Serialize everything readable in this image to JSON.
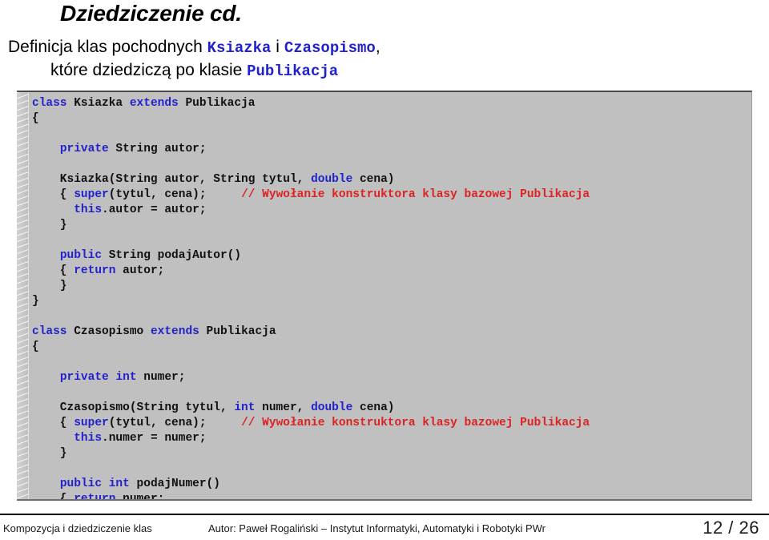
{
  "slide": {
    "title": "Dziedziczenie cd.",
    "subtitle": {
      "line1_pre": "Definicja klas pochodnych ",
      "line1_code1": "Ksiazka",
      "line1_mid": " i ",
      "line1_code2": "Czasopismo",
      "line1_post": ",",
      "line2_pre": "które dziedziczą po klasie ",
      "line2_code": "Publikacja"
    }
  },
  "colors": {
    "keyword_blue": "#2222cc",
    "comment_red": "#dd2222",
    "code_background": "#c0c0c0",
    "text_black": "#000000"
  },
  "code": {
    "language": "Java",
    "lines": [
      [
        {
          "t": "class",
          "c": "kw"
        },
        {
          "t": " Ksiazka ",
          "c": "id"
        },
        {
          "t": "extends",
          "c": "kw"
        },
        {
          "t": " Publikacja",
          "c": "id"
        }
      ],
      [
        {
          "t": "{",
          "c": "id"
        }
      ],
      [
        {
          "t": "",
          "c": "id"
        }
      ],
      [
        {
          "t": "    ",
          "c": "id"
        },
        {
          "t": "private",
          "c": "kw"
        },
        {
          "t": " String autor;",
          "c": "id"
        }
      ],
      [
        {
          "t": "",
          "c": "id"
        }
      ],
      [
        {
          "t": "    Ksiazka(String autor, String tytul, ",
          "c": "id"
        },
        {
          "t": "double",
          "c": "kw"
        },
        {
          "t": " cena)",
          "c": "id"
        }
      ],
      [
        {
          "t": "    { ",
          "c": "id"
        },
        {
          "t": "super",
          "c": "kw"
        },
        {
          "t": "(tytul, cena);     ",
          "c": "id"
        },
        {
          "t": "// Wywołanie konstruktora klasy bazowej Publikacja",
          "c": "cm"
        }
      ],
      [
        {
          "t": "      ",
          "c": "id"
        },
        {
          "t": "this",
          "c": "kw"
        },
        {
          "t": ".autor = autor;",
          "c": "id"
        }
      ],
      [
        {
          "t": "    }",
          "c": "id"
        }
      ],
      [
        {
          "t": "",
          "c": "id"
        }
      ],
      [
        {
          "t": "    ",
          "c": "id"
        },
        {
          "t": "public",
          "c": "kw"
        },
        {
          "t": " String podajAutor()",
          "c": "id"
        }
      ],
      [
        {
          "t": "    { ",
          "c": "id"
        },
        {
          "t": "return",
          "c": "kw"
        },
        {
          "t": " autor;",
          "c": "id"
        }
      ],
      [
        {
          "t": "    }",
          "c": "id"
        }
      ],
      [
        {
          "t": "}",
          "c": "id"
        }
      ],
      [
        {
          "t": "",
          "c": "id"
        }
      ],
      [
        {
          "t": "class",
          "c": "kw"
        },
        {
          "t": " Czasopismo ",
          "c": "id"
        },
        {
          "t": "extends",
          "c": "kw"
        },
        {
          "t": " Publikacja",
          "c": "id"
        }
      ],
      [
        {
          "t": "{",
          "c": "id"
        }
      ],
      [
        {
          "t": "",
          "c": "id"
        }
      ],
      [
        {
          "t": "    ",
          "c": "id"
        },
        {
          "t": "private",
          "c": "kw"
        },
        {
          "t": " ",
          "c": "id"
        },
        {
          "t": "int",
          "c": "kw"
        },
        {
          "t": " numer;",
          "c": "id"
        }
      ],
      [
        {
          "t": "",
          "c": "id"
        }
      ],
      [
        {
          "t": "    Czasopismo(String tytul, ",
          "c": "id"
        },
        {
          "t": "int",
          "c": "kw"
        },
        {
          "t": " numer, ",
          "c": "id"
        },
        {
          "t": "double",
          "c": "kw"
        },
        {
          "t": " cena)",
          "c": "id"
        }
      ],
      [
        {
          "t": "    { ",
          "c": "id"
        },
        {
          "t": "super",
          "c": "kw"
        },
        {
          "t": "(tytul, cena);     ",
          "c": "id"
        },
        {
          "t": "// Wywołanie konstruktora klasy bazowej Publikacja",
          "c": "cm"
        }
      ],
      [
        {
          "t": "      ",
          "c": "id"
        },
        {
          "t": "this",
          "c": "kw"
        },
        {
          "t": ".numer = numer;",
          "c": "id"
        }
      ],
      [
        {
          "t": "    }",
          "c": "id"
        }
      ],
      [
        {
          "t": "",
          "c": "id"
        }
      ],
      [
        {
          "t": "    ",
          "c": "id"
        },
        {
          "t": "public",
          "c": "kw"
        },
        {
          "t": " ",
          "c": "id"
        },
        {
          "t": "int",
          "c": "kw"
        },
        {
          "t": " podajNumer()",
          "c": "id"
        }
      ],
      [
        {
          "t": "    { ",
          "c": "id"
        },
        {
          "t": "return",
          "c": "kw"
        },
        {
          "t": " numer;",
          "c": "id"
        }
      ],
      [
        {
          "t": "    }",
          "c": "id"
        }
      ],
      [
        {
          "t": "}",
          "c": "id"
        }
      ]
    ]
  },
  "footer": {
    "left": "Kompozycja i dziedziczenie klas",
    "center": "Autor: Paweł Rogaliński – Instytut Informatyki, Automatyki i Robotyki PWr",
    "page_current": "12",
    "page_separator": "/",
    "page_total": "26",
    "page_label": "12 / 26"
  }
}
